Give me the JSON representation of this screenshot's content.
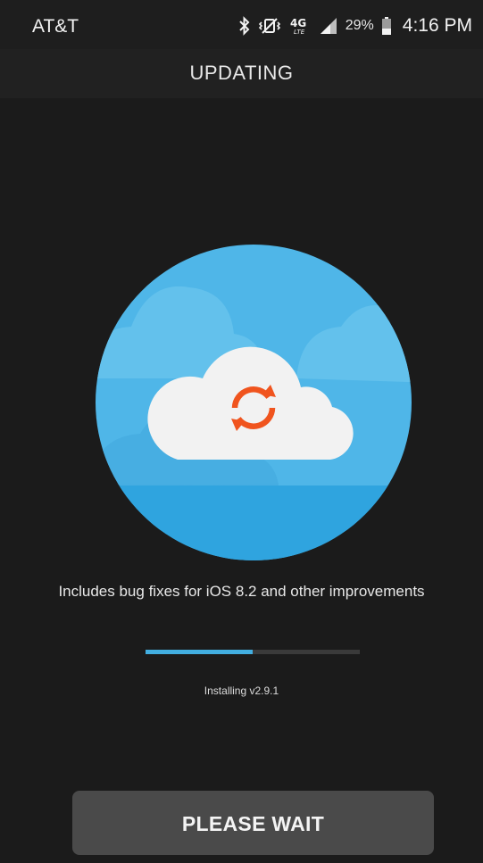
{
  "status_bar": {
    "carrier": "AT&T",
    "network_type": "4G LTE",
    "battery_percent": "29%",
    "time": "4:16 PM",
    "icons": [
      "bluetooth-icon",
      "vibrate-icon",
      "lte-icon",
      "signal-icon",
      "battery-icon"
    ]
  },
  "header": {
    "title": "UPDATING"
  },
  "main": {
    "illustration_icons": [
      "cloud-icon",
      "sync-icon"
    ],
    "description": "Includes bug fixes for iOS 8.2 and other improvements",
    "progress": 0.5,
    "install_status": "Installing v2.9.1"
  },
  "footer": {
    "button_label": "PLEASE WAIT"
  },
  "colors": {
    "background": "#1b1b1b",
    "accent_blue": "#42aee0",
    "sync_orange": "#f0541e",
    "button": "#4a4a4a"
  }
}
